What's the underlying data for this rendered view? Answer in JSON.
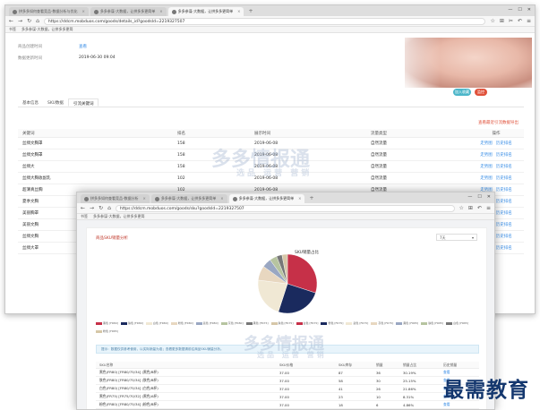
{
  "window1": {
    "tabs": [
      {
        "label": "拼多多如何查看竞品-数据分析与优化"
      },
      {
        "label": "多多参谋-大数据，让拼多多更简单"
      },
      {
        "label": "多多参谋-大数据，让拼多多更简单"
      }
    ],
    "new_tab": "+",
    "url": "https://ddcm.mobduos.com/goods/details_id?goodsId=2219327507",
    "bookmarks": [
      "书签",
      "多多参谋-大数据，让拼多多更简"
    ],
    "info": [
      {
        "label": "商品创建时间",
        "value": "查看"
      },
      {
        "label": "数据更新时间",
        "value": "2019-06-30 09:04"
      }
    ],
    "btn_a": "加入收藏",
    "btn_b": "监控",
    "page_tabs": [
      "基本信息",
      "SKU数据",
      "引流关键词"
    ],
    "export_link": "查看最近引流数据导出",
    "table_headers": [
      "关键词",
      "排名",
      "展示时间",
      "流量类型",
      "操作"
    ],
    "rows": [
      {
        "kw": "丝绸文胸罩",
        "rank": "158",
        "date": "2019-06-08",
        "type": "自然流量",
        "a1": "走势图",
        "a2": "历史排名"
      },
      {
        "kw": "丝绸文胸罩",
        "rank": "158",
        "date": "2019-06-08",
        "type": "自然流量",
        "a1": "走势图",
        "a2": "历史排名"
      },
      {
        "kw": "丝绸大",
        "rank": "158",
        "date": "2019-06-08",
        "type": "自然流量",
        "a1": "走势图",
        "a2": "历史排名"
      },
      {
        "kw": "丝绸大胸收副乳",
        "rank": "102",
        "date": "2019-06-08",
        "type": "自然流量",
        "a1": "走势图",
        "a2": "历史排名"
      },
      {
        "kw": "超薄真丝胸",
        "rank": "102",
        "date": "2019-06-08",
        "type": "自然流量",
        "a1": "走势图",
        "a2": "历史排名"
      },
      {
        "kw": "夏季文胸",
        "rank": "",
        "date": "",
        "type": "",
        "a1": "走势图",
        "a2": "历史排名"
      },
      {
        "kw": "美丽胸罩",
        "rank": "",
        "date": "",
        "type": "",
        "a1": "走势图",
        "a2": "历史排名"
      },
      {
        "kw": "美丽文胸",
        "rank": "",
        "date": "",
        "type": "",
        "a1": "走势图",
        "a2": "历史排名"
      },
      {
        "kw": "丝绸文胸",
        "rank": "",
        "date": "",
        "type": "",
        "a1": "走势图",
        "a2": "历史排名"
      },
      {
        "kw": "丝绸大罩",
        "rank": "",
        "date": "",
        "type": "",
        "a1": "走势图",
        "a2": "历史排名"
      }
    ],
    "watermark_main": "多多情报通",
    "watermark_sub": "选品 运营 营销"
  },
  "window2": {
    "tabs": [
      {
        "label": "拼多多如何查看竞品-数据分析"
      },
      {
        "label": "多多参谋-大数据，让拼多多更简单"
      },
      {
        "label": "多多参谋-大数据，让拼多多更简单"
      }
    ],
    "url": "https://ddcm.mobduos.com/goods/sku?goodsId=2219327507",
    "bookmarks": [
      "书签",
      "多多参谋-大数据，让拼多多更简"
    ],
    "section_title": "商品SKU销量分析",
    "select_value": "7天",
    "chart_data": {
      "type": "pie",
      "title": "SKU销量占比",
      "series": [
        {
          "values": [
            30,
            25,
            22,
            8,
            5,
            4,
            3,
            3
          ]
        }
      ],
      "colors": [
        "#c63048",
        "#1a2a5e",
        "#f0e8d4",
        "#e8d7c0",
        "#9aa7c2",
        "#b7c4a0",
        "#777777",
        "#d6c7a8"
      ]
    },
    "legend_items": [
      "黑色 [FR80]",
      "肤色 [FR80]",
      "白色 [FR80]",
      "粉色 [FR80]",
      "蓝色 [FR80]",
      "灰色 [FR80]",
      "黑色 [FR75]",
      "肤色 [FR75]",
      "白色 [FR75]",
      "粉色 [FR75]",
      "蓝色 [FR75]",
      "灰色 [FR75]",
      "黑色 [FR85]",
      "肤色 [FR85]",
      "白色 [FR85]",
      "粉色 [FR85]"
    ],
    "notice": "提示：数据仅供参考使用，以实际销量为准；查看更多数据请前往商品SKU销量分析。",
    "table_headers": [
      "SKU名称",
      "SKU价格",
      "SKU库存",
      "销量",
      "销量占比",
      "历史销量"
    ],
    "rows": [
      {
        "name": "黑色(FR80) [FR80/75/34]  (黑色/B杯)",
        "price": "37.00",
        "stock": "87",
        "sales": "36",
        "pct": "30.19%",
        "hist": "查看"
      },
      {
        "name": "肤色(FR80) [FR80/75/34]  (肤色/B杯)",
        "price": "37.00",
        "stock": "58",
        "sales": "30",
        "pct": "25.15%",
        "hist": "查看"
      },
      {
        "name": "白色(FR80) [FR80/75/34]  (白色/B杯)",
        "price": "37.00",
        "stock": "41",
        "sales": "26",
        "pct": "21.86%",
        "hist": "查看"
      },
      {
        "name": "黑色(FR75) [FR75/70/32]  (黑色/A杯)",
        "price": "37.00",
        "stock": "23",
        "sales": "10",
        "pct": "8.31%",
        "hist": "查看"
      },
      {
        "name": "粉色(FR80) [FR80/75/34]  (粉色/B杯)",
        "price": "37.00",
        "stock": "18",
        "sales": "6",
        "pct": "4.86%",
        "hist": "查看"
      }
    ],
    "watermark_main": "多多情报通",
    "watermark_sub": "选品 运营 营销"
  },
  "brand_caption": "最需教育",
  "colors": {
    "accent": "#3a8ee6",
    "danger": "#e0513a",
    "teal": "#4cb6c9"
  }
}
